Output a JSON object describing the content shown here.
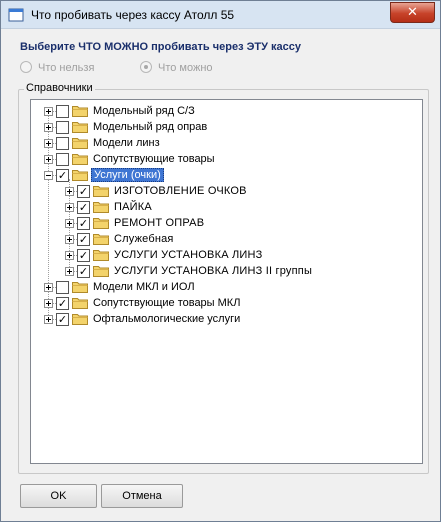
{
  "window": {
    "title": "Что пробивать через кассу Атолл 55",
    "close_glyph": "✕"
  },
  "heading": "Выберите ЧТО МОЖНО пробивать через ЭТУ кассу",
  "radios": {
    "not_allowed": "Что нельзя",
    "allowed": "Что можно",
    "selected": "allowed"
  },
  "group_label": "Справочники",
  "tree": [
    {
      "label": "Модельный ряд С/З",
      "checked": false,
      "level": 0,
      "expanded": false,
      "selected": false
    },
    {
      "label": "Модельный ряд оправ",
      "checked": false,
      "level": 0,
      "expanded": false,
      "selected": false
    },
    {
      "label": "Модели линз",
      "checked": false,
      "level": 0,
      "expanded": false,
      "selected": false
    },
    {
      "label": "Сопутствующие товары",
      "checked": false,
      "level": 0,
      "expanded": false,
      "selected": false
    },
    {
      "label": "Услуги (очки)",
      "checked": true,
      "level": 0,
      "expanded": true,
      "selected": true
    },
    {
      "label": "ИЗГОТОВЛЕНИЕ ОЧКОВ",
      "checked": true,
      "level": 1,
      "expanded": false,
      "selected": false
    },
    {
      "label": "ПАЙКА",
      "checked": true,
      "level": 1,
      "expanded": false,
      "selected": false
    },
    {
      "label": "РЕМОНТ ОПРАВ",
      "checked": true,
      "level": 1,
      "expanded": false,
      "selected": false
    },
    {
      "label": "Служебная",
      "checked": true,
      "level": 1,
      "expanded": false,
      "selected": false
    },
    {
      "label": "УСЛУГИ УСТАНОВКА ЛИНЗ",
      "checked": true,
      "level": 1,
      "expanded": false,
      "selected": false
    },
    {
      "label": "УСЛУГИ УСТАНОВКА ЛИНЗ II группы",
      "checked": true,
      "level": 1,
      "expanded": false,
      "selected": false
    },
    {
      "label": "Модели МКЛ и ИОЛ",
      "checked": false,
      "level": 0,
      "expanded": false,
      "selected": false
    },
    {
      "label": "Сопутствующие товары МКЛ",
      "checked": true,
      "level": 0,
      "expanded": false,
      "selected": false
    },
    {
      "label": "Офтальмологические услуги",
      "checked": true,
      "level": 0,
      "expanded": false,
      "selected": false
    }
  ],
  "buttons": {
    "ok": "OK",
    "cancel": "Отмена"
  },
  "icons": {
    "app": "window-app-icon",
    "folder": "folder-icon",
    "folder_color": "#f3d36b",
    "selection_color": "#3f76d3"
  }
}
